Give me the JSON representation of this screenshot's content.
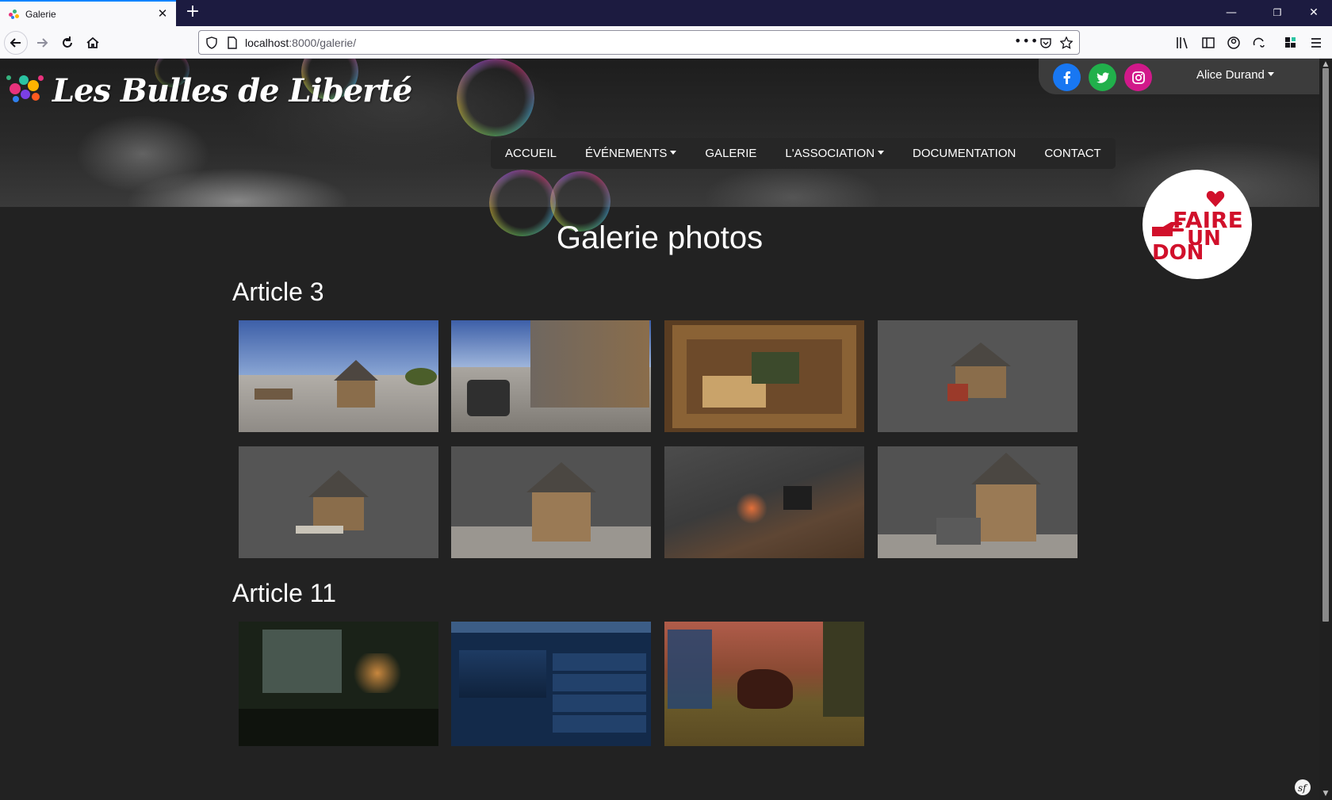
{
  "browser": {
    "tab_title": "Galerie",
    "url_host": "localhost",
    "url_path": ":8000/galerie/"
  },
  "site": {
    "logo_text": "Les Bulles de Liberté",
    "user_name": "Alice Durand",
    "social": [
      "facebook-icon",
      "twitter-icon",
      "instagram-icon"
    ],
    "nav": {
      "accueil": "ACCUEIL",
      "evenements": "ÉVÉNEMENTS",
      "galerie": "GALERIE",
      "association": "L'ASSOCIATION",
      "documentation": "DOCUMENTATION",
      "contact": "CONTACT"
    },
    "donate": {
      "line1": "FAIRE",
      "line2": "UN",
      "line3": "DON"
    }
  },
  "gallery": {
    "title": "Galerie photos",
    "sections": [
      {
        "title": "Article 3",
        "photo_count": 8
      },
      {
        "title": "Article 11",
        "photo_count": 3
      }
    ]
  },
  "colors": {
    "page_bg": "#222222",
    "facebook": "#1877f2",
    "twitter": "#1da1f2",
    "instagram": "#e1306c",
    "donate_red": "#d1102b"
  }
}
